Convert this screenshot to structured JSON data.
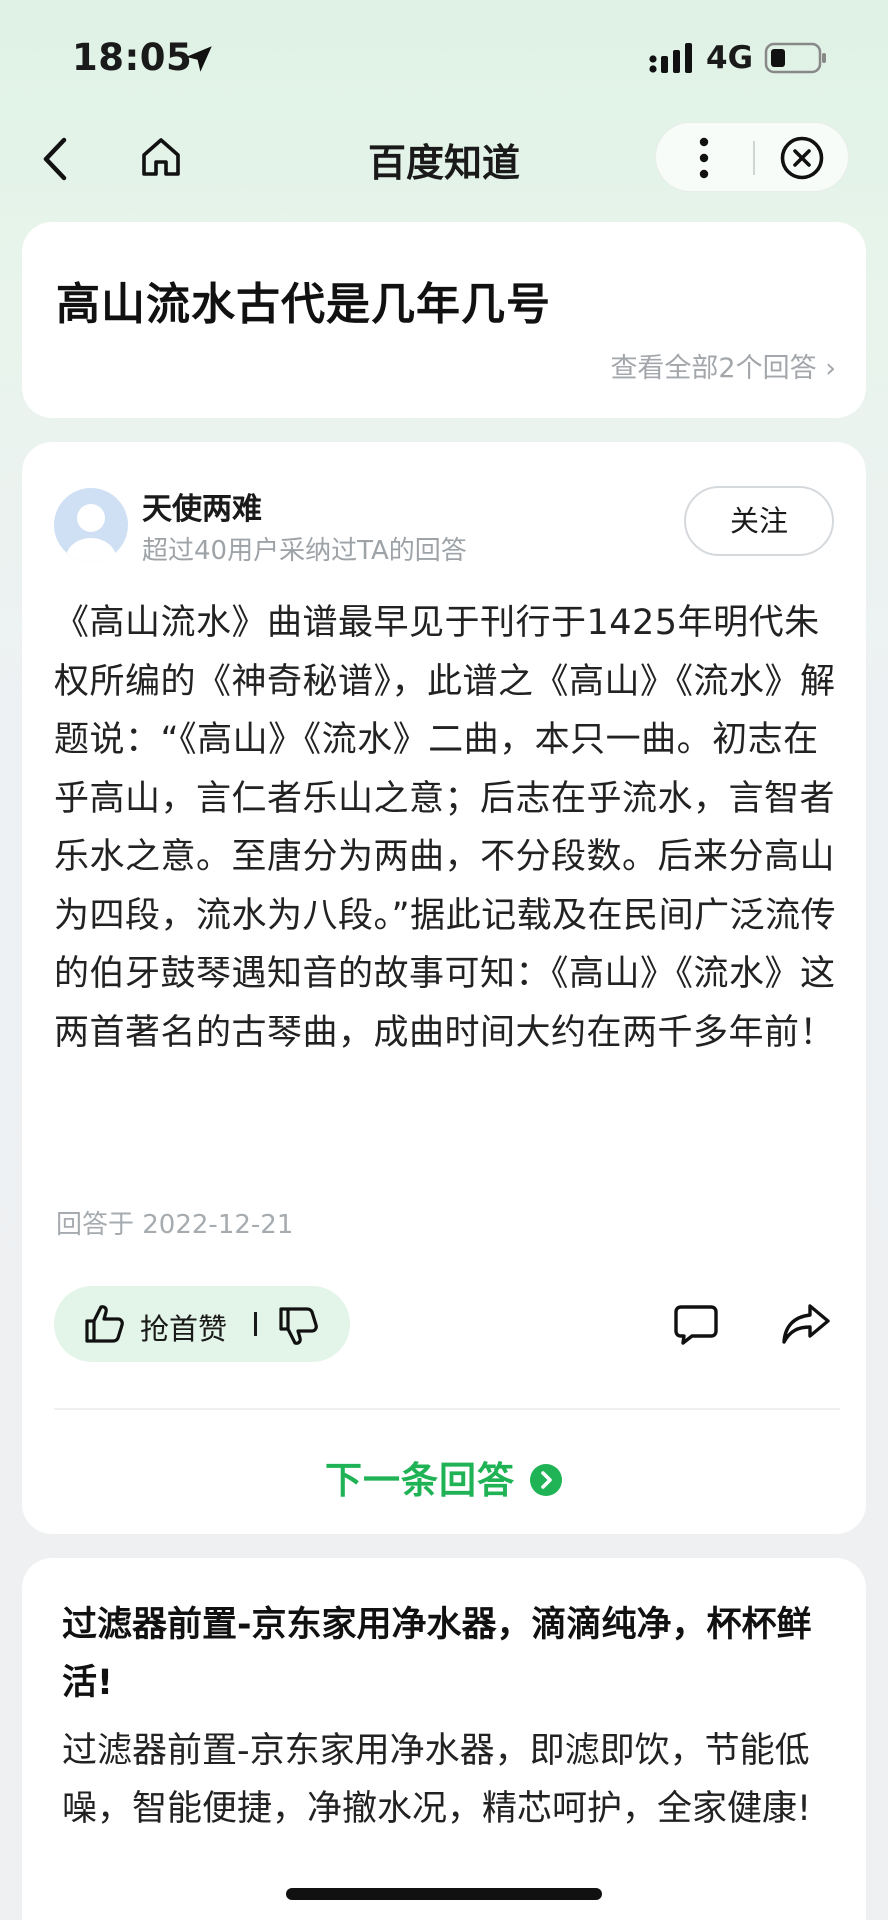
{
  "status_bar": {
    "time": "18:05",
    "network": "4G",
    "icons": [
      "location-arrow-icon",
      "signal-icon",
      "battery-icon"
    ]
  },
  "nav": {
    "title": "百度知道",
    "icons": [
      "back-icon",
      "home-icon",
      "more-icon",
      "close-icon"
    ]
  },
  "question": {
    "title": "高山流水古代是几年几号",
    "view_all": "查看全部2个回答 ›"
  },
  "answer": {
    "author": "天使两难",
    "author_sub": "超过40用户采纳过TA的回答",
    "follow_label": "关注",
    "body": "《高山流水》曲谱最早见于刊行于1425年明代朱权所编的《神奇秘谱》，此谱之《高山》《流水》解题说：“《高山》《流水》二曲，本只一曲。初志在乎高山，言仁者乐山之意；后志在乎流水，言智者乐水之意。至唐分为两曲，不分段数。后来分高山为四段，流水为八段。”据此记载及在民间广泛流传的伯牙鼓琴遇知音的故事可知：《高山》《流水》这两首著名的古琴曲，成曲时间大约在两千多年前！",
    "date": "回答于 2022-12-21",
    "vote_label": "抢首赞",
    "next_label": "下一条回答",
    "accent_color": "#1fb356"
  },
  "ad": {
    "title": "过滤器前置-京东家用净水器，滴滴纯净，杯杯鲜活!",
    "body": "过滤器前置-京东家用净水器，即滤即饮，节能低噪，智能便捷，净撤水况，精芯呵护，全家健康!"
  }
}
